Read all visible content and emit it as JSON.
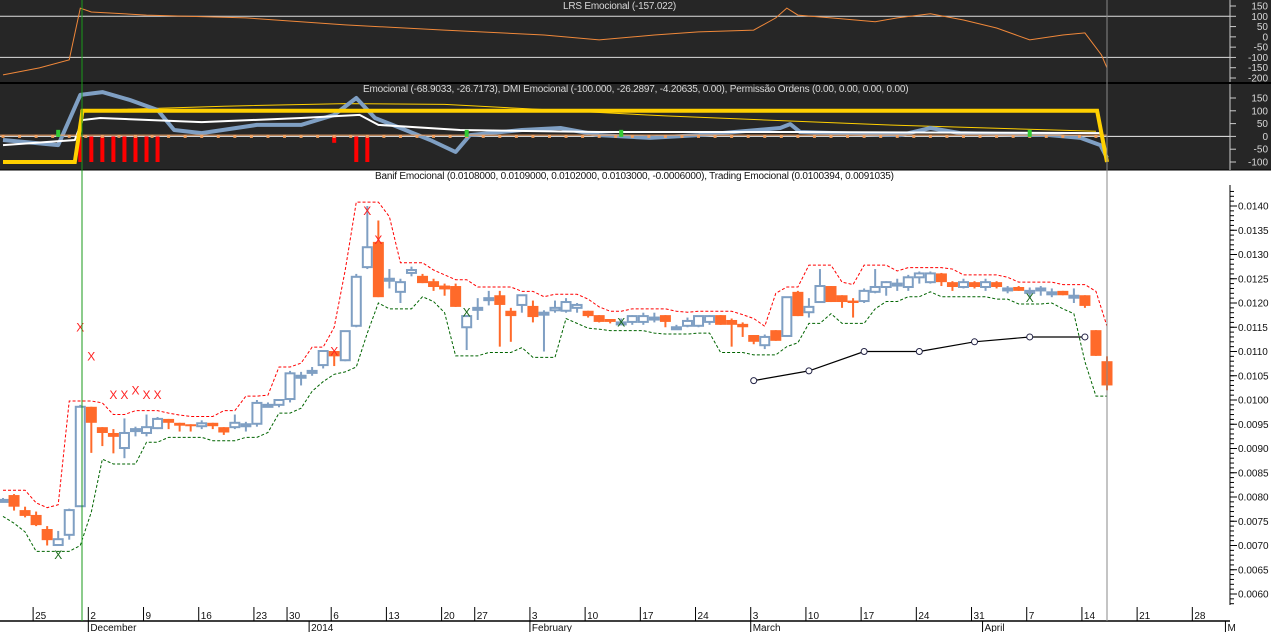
{
  "panels": {
    "lrs": {
      "title": "LRS Emocional (-157.022)",
      "axis_ticks": [
        150,
        100,
        50,
        0,
        -50,
        -100,
        -150,
        -200
      ]
    },
    "emocional": {
      "title": "Emocional (-68.9033, -26.7173), DMI Emocional (-100.000, -26.2897, -4.20635, 0.00), Permissão Ordens (0.00, 0.00, 0.00, 0.00)",
      "axis_ticks": [
        150,
        100,
        50,
        0,
        -50,
        -100
      ]
    },
    "price": {
      "title": "Banif Emocional (0.0108000, 0.0109000, 0.0102000, 0.0103000, -0.0006000), Trading Emocional (0.0100394, 0.0091035)"
    }
  },
  "colors": {
    "bg_dark": "#262626",
    "bull": "#7f9fc3",
    "bear": "#ff6a2a",
    "upper_band": "#ff0000",
    "lower_band": "#006400",
    "lrs_line": "#f0883a",
    "permission": "#ffd000",
    "dmi": "#7f9fc3",
    "marker_line": "#000000"
  },
  "chart_data": {
    "type": "candlestick",
    "price_axis": {
      "ticks": [
        "0.0140",
        "0.0135",
        "0.0130",
        "0.0125",
        "0.0120",
        "0.0115",
        "0.0110",
        "0.0105",
        "0.0100",
        "0.0095",
        "0.0090",
        "0.0085",
        "0.0080",
        "0.0075",
        "0.0070",
        "0.0065",
        "0.0060"
      ],
      "ylim": [
        0.0058,
        0.0143
      ]
    },
    "time_axis": {
      "days": [
        {
          "label": "25",
          "i": 3
        },
        {
          "label": "2",
          "i": 8
        },
        {
          "label": "9",
          "i": 13
        },
        {
          "label": "16",
          "i": 18
        },
        {
          "label": "23",
          "i": 23
        },
        {
          "label": "30",
          "i": 26
        },
        {
          "label": "6",
          "i": 30
        },
        {
          "label": "13",
          "i": 35
        },
        {
          "label": "20",
          "i": 40
        },
        {
          "label": "27",
          "i": 43
        },
        {
          "label": "3",
          "i": 48
        },
        {
          "label": "10",
          "i": 53
        },
        {
          "label": "17",
          "i": 58
        },
        {
          "label": "24",
          "i": 63
        },
        {
          "label": "3",
          "i": 68
        },
        {
          "label": "10",
          "i": 73
        },
        {
          "label": "17",
          "i": 78
        },
        {
          "label": "24",
          "i": 83
        },
        {
          "label": "31",
          "i": 88
        },
        {
          "label": "7",
          "i": 93
        },
        {
          "label": "14",
          "i": 98
        },
        {
          "label": "21",
          "i": 103
        },
        {
          "label": "28",
          "i": 108
        }
      ],
      "months": [
        {
          "label": "December",
          "i": 8
        },
        {
          "label": "2014",
          "i": 28
        },
        {
          "label": "February",
          "i": 48
        },
        {
          "label": "March",
          "i": 68
        },
        {
          "label": "April",
          "i": 89
        },
        {
          "label": "M",
          "i": 111
        }
      ]
    },
    "ohlc": [
      [
        0.00794,
        0.00798,
        0.0079,
        0.00794
      ],
      [
        0.00804,
        0.00806,
        0.00772,
        0.0078
      ],
      [
        0.00773,
        0.0078,
        0.00758,
        0.00761
      ],
      [
        0.00763,
        0.0077,
        0.0074,
        0.00742
      ],
      [
        0.00734,
        0.0074,
        0.007,
        0.00711
      ],
      [
        0.00701,
        0.0073,
        0.007,
        0.00713
      ],
      [
        0.00722,
        0.00776,
        0.00712,
        0.00773
      ],
      [
        0.00781,
        0.0099,
        0.00781,
        0.00986
      ],
      [
        0.00986,
        0.00986,
        0.00891,
        0.00953
      ],
      [
        0.00944,
        0.00944,
        0.00905,
        0.00932
      ],
      [
        0.00932,
        0.0094,
        0.0089,
        0.00924
      ],
      [
        0.00901,
        0.00962,
        0.0088,
        0.00932
      ],
      [
        0.0094,
        0.00945,
        0.00925,
        0.0094
      ],
      [
        0.00932,
        0.0097,
        0.00925,
        0.00944
      ],
      [
        0.00942,
        0.00965,
        0.0094,
        0.00961
      ],
      [
        0.00961,
        0.00961,
        0.0094,
        0.00953
      ],
      [
        0.00953,
        0.00953,
        0.00935,
        0.00947
      ],
      [
        0.0095,
        0.0095,
        0.00935,
        0.00947
      ],
      [
        0.00946,
        0.00958,
        0.0094,
        0.00952
      ],
      [
        0.00953,
        0.00953,
        0.0094,
        0.00946
      ],
      [
        0.00944,
        0.00944,
        0.00928,
        0.00933
      ],
      [
        0.00944,
        0.0097,
        0.0094,
        0.00953
      ],
      [
        0.0095,
        0.00955,
        0.00935,
        0.0095
      ],
      [
        0.00951,
        0.01,
        0.00945,
        0.00994
      ],
      [
        0.0099,
        0.00995,
        0.00985,
        0.0099
      ],
      [
        0.0099,
        0.01002,
        0.00985,
        0.01
      ],
      [
        0.01002,
        0.0106,
        0.00995,
        0.01055
      ],
      [
        0.0105,
        0.01058,
        0.0103,
        0.0105
      ],
      [
        0.0106,
        0.01068,
        0.0105,
        0.0106
      ],
      [
        0.01072,
        0.01101,
        0.01065,
        0.01101
      ],
      [
        0.01101,
        0.01101,
        0.0107,
        0.0109
      ],
      [
        0.01082,
        0.01142,
        0.0108,
        0.01142
      ],
      [
        0.01153,
        0.0126,
        0.0115,
        0.01254
      ],
      [
        0.01274,
        0.014,
        0.0127,
        0.01315
      ],
      [
        0.01326,
        0.0137,
        0.01212,
        0.01212
      ],
      [
        0.0125,
        0.0127,
        0.0123,
        0.0125
      ],
      [
        0.01223,
        0.0125,
        0.012,
        0.01243
      ],
      [
        0.01262,
        0.01275,
        0.01255,
        0.01268
      ],
      [
        0.01256,
        0.0126,
        0.01241,
        0.01241
      ],
      [
        0.01245,
        0.0125,
        0.01225,
        0.01233
      ],
      [
        0.01236,
        0.0124,
        0.01215,
        0.01228
      ],
      [
        0.01235,
        0.0124,
        0.01192,
        0.01192
      ],
      [
        0.0115,
        0.01175,
        0.01103,
        0.01173
      ],
      [
        0.0119,
        0.0121,
        0.01165,
        0.0119
      ],
      [
        0.0121,
        0.01225,
        0.01195,
        0.0121
      ],
      [
        0.01216,
        0.01225,
        0.0111,
        0.01196
      ],
      [
        0.01184,
        0.0119,
        0.0112,
        0.01173
      ],
      [
        0.01196,
        0.01216,
        0.0118,
        0.01216
      ],
      [
        0.01194,
        0.01205,
        0.0116,
        0.01171
      ],
      [
        0.0118,
        0.01185,
        0.011,
        0.0118
      ],
      [
        0.01185,
        0.01205,
        0.0118,
        0.0119
      ],
      [
        0.01184,
        0.0121,
        0.0118,
        0.01202
      ],
      [
        0.0119,
        0.012,
        0.0118,
        0.01196
      ],
      [
        0.01184,
        0.01184,
        0.0117,
        0.01173
      ],
      [
        0.01175,
        0.01175,
        0.0116,
        0.01161
      ],
      [
        0.01167,
        0.01167,
        0.01158,
        0.01161
      ],
      [
        0.0116,
        0.01168,
        0.01155,
        0.0116
      ],
      [
        0.01161,
        0.01175,
        0.01155,
        0.01173
      ],
      [
        0.01161,
        0.0118,
        0.01155,
        0.01173
      ],
      [
        0.0117,
        0.0118,
        0.0116,
        0.0117
      ],
      [
        0.01175,
        0.01175,
        0.0115,
        0.01161
      ],
      [
        0.0115,
        0.01155,
        0.01148,
        0.0115
      ],
      [
        0.01153,
        0.0117,
        0.0115,
        0.01163
      ],
      [
        0.01153,
        0.01173,
        0.0115,
        0.01173
      ],
      [
        0.01161,
        0.01175,
        0.01155,
        0.01173
      ],
      [
        0.01175,
        0.01175,
        0.01155,
        0.01155
      ],
      [
        0.01165,
        0.01168,
        0.0111,
        0.01155
      ],
      [
        0.01157,
        0.0116,
        0.0113,
        0.0115
      ],
      [
        0.01134,
        0.01134,
        0.01115,
        0.0112
      ],
      [
        0.01113,
        0.01135,
        0.01105,
        0.0113
      ],
      [
        0.01144,
        0.01144,
        0.01122,
        0.01122
      ],
      [
        0.01132,
        0.01212,
        0.0113,
        0.01212
      ],
      [
        0.01223,
        0.01225,
        0.01173,
        0.01173
      ],
      [
        0.01181,
        0.0121,
        0.0117,
        0.01192
      ],
      [
        0.01202,
        0.0127,
        0.012,
        0.01235
      ],
      [
        0.01235,
        0.01235,
        0.01202,
        0.01202
      ],
      [
        0.01216,
        0.01216,
        0.0119,
        0.01202
      ],
      [
        0.01205,
        0.0121,
        0.0117,
        0.012
      ],
      [
        0.01204,
        0.0123,
        0.012,
        0.01225
      ],
      [
        0.01223,
        0.0127,
        0.0122,
        0.01233
      ],
      [
        0.01233,
        0.01245,
        0.01215,
        0.01243
      ],
      [
        0.0124,
        0.0125,
        0.01225,
        0.0124
      ],
      [
        0.01233,
        0.01258,
        0.01225,
        0.01253
      ],
      [
        0.01253,
        0.01265,
        0.0124,
        0.01261
      ],
      [
        0.01243,
        0.01265,
        0.0124,
        0.01261
      ],
      [
        0.01261,
        0.01262,
        0.01235,
        0.01243
      ],
      [
        0.01243,
        0.01245,
        0.01225,
        0.01233
      ],
      [
        0.01233,
        0.0125,
        0.0123,
        0.01243
      ],
      [
        0.01243,
        0.01245,
        0.0123,
        0.01233
      ],
      [
        0.01233,
        0.0125,
        0.01225,
        0.01243
      ],
      [
        0.01243,
        0.01245,
        0.0123,
        0.01233
      ],
      [
        0.0123,
        0.01235,
        0.0122,
        0.0123
      ],
      [
        0.01233,
        0.01235,
        0.01225,
        0.01225
      ],
      [
        0.01225,
        0.01232,
        0.0121,
        0.01225
      ],
      [
        0.0123,
        0.01235,
        0.01215,
        0.0123
      ],
      [
        0.01222,
        0.0123,
        0.01212,
        0.01222
      ],
      [
        0.01225,
        0.01225,
        0.01216,
        0.01216
      ],
      [
        0.01215,
        0.0123,
        0.012,
        0.01215
      ],
      [
        0.01216,
        0.01216,
        0.0119,
        0.01194
      ],
      [
        0.01144,
        0.01144,
        0.01091,
        0.01091
      ],
      [
        0.0108,
        0.0109,
        0.0102,
        0.0103
      ]
    ],
    "trend_line": [
      [
        68,
        0.0104
      ],
      [
        73,
        0.0106
      ],
      [
        78,
        0.011
      ],
      [
        83,
        0.011
      ],
      [
        88,
        0.0112
      ],
      [
        93,
        0.0113
      ],
      [
        98,
        0.0113
      ]
    ],
    "sell_marks": [
      [
        7,
        0.0115
      ],
      [
        8,
        0.0109
      ],
      [
        10,
        0.0101
      ],
      [
        11,
        0.0101
      ],
      [
        12,
        0.0102
      ],
      [
        13,
        0.0101
      ],
      [
        14,
        0.0101
      ],
      [
        30,
        0.011
      ],
      [
        33,
        0.0139
      ],
      [
        34,
        0.0133
      ]
    ],
    "buy_marks": [
      [
        5,
        0.0068
      ],
      [
        42,
        0.0118
      ],
      [
        56,
        0.0116
      ],
      [
        93,
        0.0121
      ]
    ],
    "lrs": [
      [
        0,
        -185
      ],
      [
        3.3,
        -151
      ],
      [
        6,
        -112
      ],
      [
        7,
        140
      ],
      [
        8,
        121
      ],
      [
        13,
        106
      ],
      [
        22,
        92
      ],
      [
        31,
        58
      ],
      [
        40,
        33
      ],
      [
        49,
        9
      ],
      [
        54,
        -15
      ],
      [
        59,
        9
      ],
      [
        63,
        24
      ],
      [
        68,
        33
      ],
      [
        70,
        92
      ],
      [
        71,
        140
      ],
      [
        72,
        106
      ],
      [
        75,
        92
      ],
      [
        79,
        73
      ],
      [
        81,
        92
      ],
      [
        84,
        112
      ],
      [
        87,
        82
      ],
      [
        90,
        43
      ],
      [
        93,
        -15
      ],
      [
        96,
        9
      ],
      [
        98,
        19
      ],
      [
        99.5,
        -88
      ],
      [
        100,
        -151
      ]
    ],
    "dmi": [
      [
        0,
        -14
      ],
      [
        5,
        -34
      ],
      [
        7,
        162
      ],
      [
        9,
        173
      ],
      [
        11.5,
        142
      ],
      [
        14,
        103
      ],
      [
        15.5,
        25
      ],
      [
        18,
        13
      ],
      [
        23,
        45
      ],
      [
        27,
        45
      ],
      [
        30,
        84
      ],
      [
        32,
        150
      ],
      [
        33.7,
        72
      ],
      [
        36,
        33
      ],
      [
        38.7,
        -14
      ],
      [
        41,
        -61
      ],
      [
        42.3,
        5
      ],
      [
        47,
        25
      ],
      [
        50.5,
        33
      ],
      [
        54,
        5
      ],
      [
        58.6,
        -6
      ],
      [
        63,
        5
      ],
      [
        70.4,
        33
      ],
      [
        71.3,
        48
      ],
      [
        72.2,
        17
      ],
      [
        81.3,
        5
      ],
      [
        84,
        33
      ],
      [
        86.7,
        13
      ],
      [
        94.8,
        5
      ],
      [
        97.6,
        -6
      ],
      [
        99.4,
        -34
      ],
      [
        100,
        -84
      ]
    ],
    "emocional": [
      [
        0,
        -34
      ],
      [
        6.5,
        -14
      ],
      [
        7.2,
        64
      ],
      [
        8.8,
        72
      ],
      [
        18,
        56
      ],
      [
        27,
        72
      ],
      [
        32.3,
        84
      ],
      [
        34,
        45
      ],
      [
        41.4,
        25
      ],
      [
        54,
        17
      ],
      [
        72,
        17
      ],
      [
        99.4,
        13
      ],
      [
        100,
        -92
      ]
    ],
    "permission": [
      [
        0,
        -100
      ],
      [
        6.5,
        -100
      ],
      [
        7.2,
        100
      ],
      [
        99.1,
        100
      ],
      [
        100,
        -100
      ]
    ],
    "permission_trend": [
      [
        7,
        100
      ],
      [
        20,
        118
      ],
      [
        31,
        128
      ],
      [
        40,
        125
      ],
      [
        60,
        80
      ],
      [
        80,
        45
      ],
      [
        99,
        20
      ]
    ],
    "dmi_bars": [
      [
        7,
        -100
      ],
      [
        8,
        -100
      ],
      [
        9,
        -100
      ],
      [
        10,
        -100
      ],
      [
        11,
        -100
      ],
      [
        12,
        -100
      ],
      [
        13,
        -100
      ],
      [
        14,
        -100
      ],
      [
        30,
        -25
      ],
      [
        32,
        -100
      ],
      [
        33,
        -100
      ]
    ]
  }
}
